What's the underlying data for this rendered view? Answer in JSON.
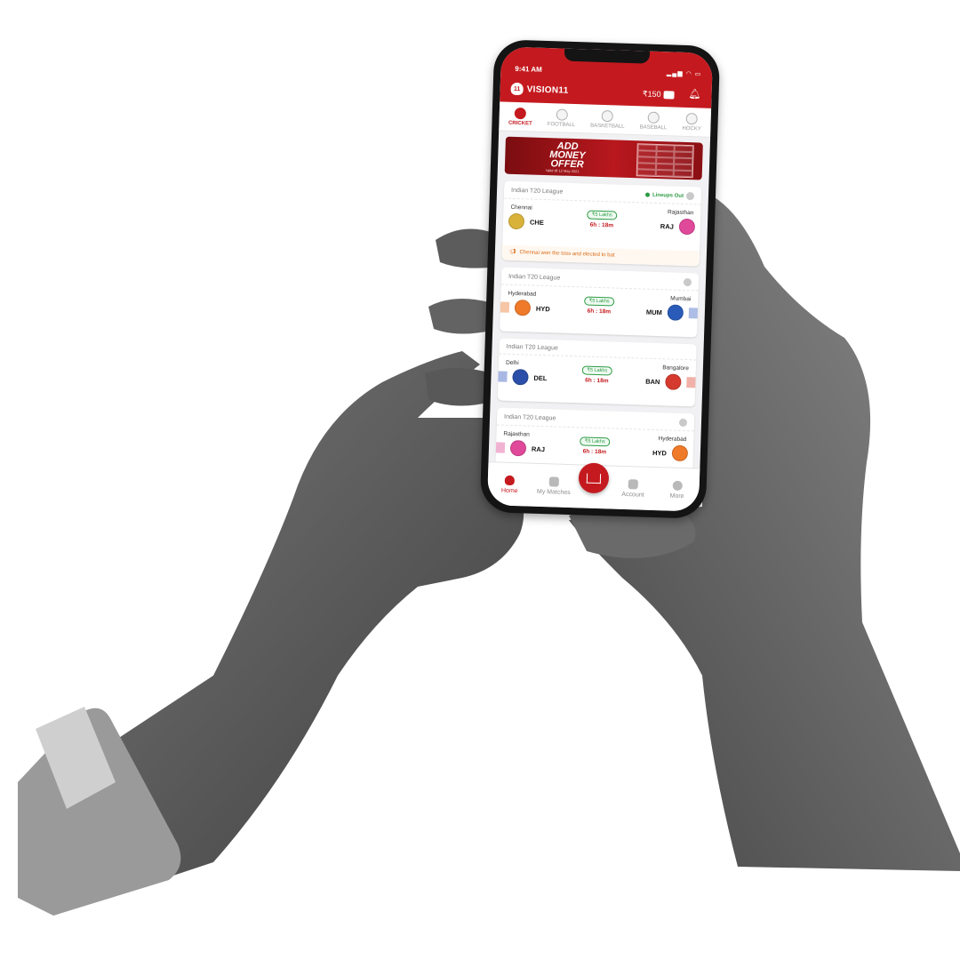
{
  "status": {
    "time": "9:41 AM",
    "icons": "▂▄▆ ◠ ▭"
  },
  "header": {
    "brand": "VISION11",
    "logo_mark": "11",
    "balance": "₹150"
  },
  "sport_tabs": [
    {
      "label": "CRICKET",
      "active": true
    },
    {
      "label": "FOOTBALL",
      "active": false
    },
    {
      "label": "BASKETBALL",
      "active": false
    },
    {
      "label": "BASEBALL",
      "active": false
    },
    {
      "label": "HOCKY",
      "active": false
    }
  ],
  "banner": {
    "title": "ADD MONEY OFFER",
    "subtitle": "Valid till 12 May 2021"
  },
  "matches": [
    {
      "league": "Indian T20 League",
      "lineups": "Lineups Out",
      "home_name": "Chennai",
      "home_code": "CHE",
      "home_color": "#d9b23a",
      "away_name": "Rajasthan",
      "away_code": "RAJ",
      "away_color": "#e0489a",
      "prize": "₹5 Lakhs",
      "timer": "6h : 18m",
      "toss": "Chennai won the toss and elected to bat"
    },
    {
      "league": "Indian T20 League",
      "home_name": "Hyderabad",
      "home_code": "HYD",
      "home_color": "#ee7a2a",
      "away_name": "Mumbai",
      "away_code": "MUM",
      "away_color": "#2a5bb8",
      "prize": "₹5 Lakhs",
      "timer": "6h : 18m"
    },
    {
      "league": "Indian T20 League",
      "home_name": "Delhi",
      "home_code": "DEL",
      "home_color": "#2b4fa8",
      "away_name": "Bangalore",
      "away_code": "BAN",
      "away_color": "#d63a2f",
      "prize": "₹5 Lakhs",
      "timer": "6h : 18m"
    },
    {
      "league": "Indian T20 League",
      "home_name": "Rajasthan",
      "home_code": "RAJ",
      "home_color": "#e0489a",
      "away_name": "Hyderabad",
      "away_code": "HYD",
      "away_color": "#ee7a2a",
      "prize": "₹5 Lakhs",
      "timer": "6h : 18m"
    }
  ],
  "bottom_nav": {
    "home": "Home",
    "my_matches": "My Matches",
    "account": "Account",
    "more": "More"
  },
  "colors": {
    "brand_red": "#c41a1f",
    "accent_green": "#2d9b44",
    "toss_orange": "#d96a14"
  }
}
